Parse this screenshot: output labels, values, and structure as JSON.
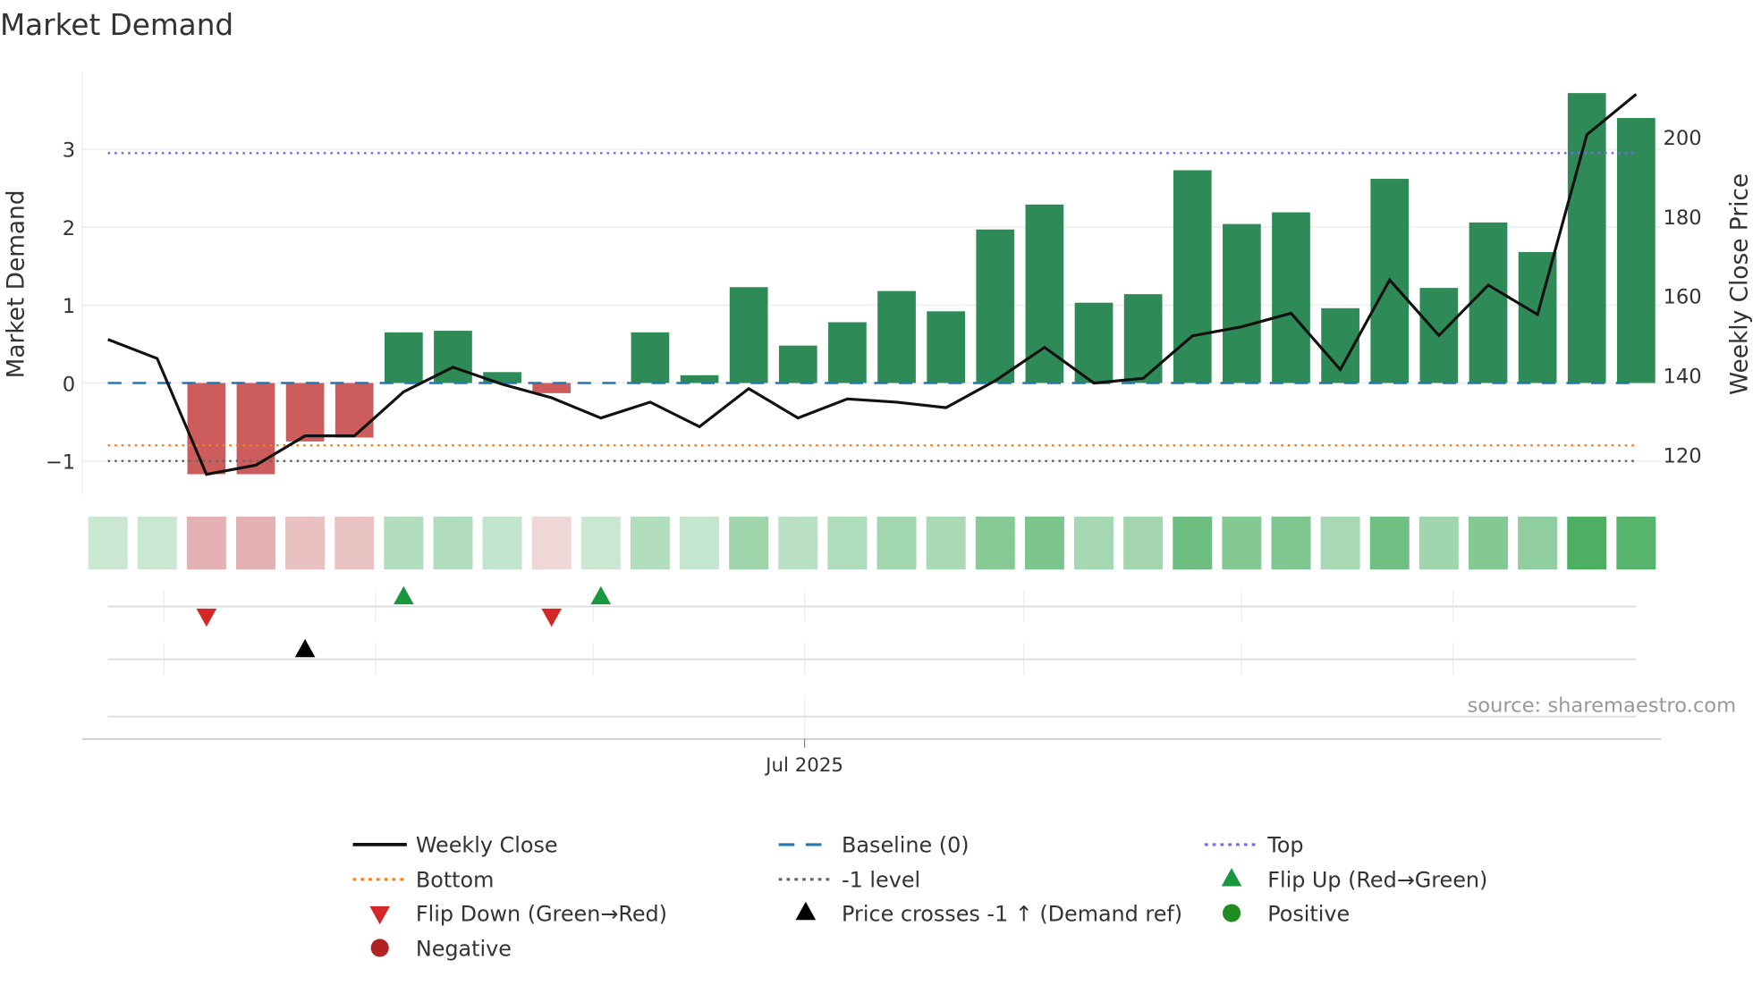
{
  "chart_data": {
    "type": "bar",
    "title": "Market Demand",
    "ylabel": "Market Demand",
    "y2label": "Weekly Close Price",
    "ylim": [
      -1.45,
      3.95
    ],
    "y2lim": [
      111.5,
      212.5
    ],
    "yticks": [
      -1,
      0,
      1,
      2,
      3
    ],
    "ytick_labels": [
      "−1",
      "0",
      "1",
      "2",
      "3"
    ],
    "y2ticks": [
      120,
      140,
      160,
      180,
      200
    ],
    "y2tick_labels": [
      "120",
      "140",
      "160",
      "180",
      "200"
    ],
    "xtick_label": "Jul 2025",
    "source": "source: sharemaestro.com",
    "demand": [
      0.0,
      0.0,
      -1.17,
      -1.17,
      -0.75,
      -0.7,
      0.65,
      0.67,
      0.14,
      -0.13,
      0.0,
      0.65,
      0.1,
      1.23,
      0.48,
      0.78,
      1.18,
      0.92,
      1.97,
      2.29,
      1.03,
      1.14,
      2.73,
      2.04,
      2.19,
      0.96,
      2.62,
      1.22,
      2.06,
      1.68,
      3.72,
      3.4
    ],
    "weekly_close": [
      149.0,
      144.2,
      115.0,
      117.3,
      124.7,
      124.7,
      135.8,
      142.0,
      137.7,
      134.3,
      129.2,
      133.2,
      127.0,
      136.6,
      129.2,
      134.0,
      133.2,
      131.8,
      138.6,
      147.0,
      138.0,
      139.2,
      149.9,
      152.2,
      155.6,
      141.4,
      164.0,
      150.0,
      162.7,
      155.3,
      200.6,
      210.8
    ],
    "levels": {
      "top": 2.95,
      "bottom": -0.8,
      "minus_one": -1,
      "baseline": 0
    },
    "flip_up_weeks": [
      6,
      10
    ],
    "flip_down_weeks": [
      2,
      9
    ],
    "price_cross_weeks": [
      4
    ],
    "colors": {
      "positive": "#2e8b57",
      "negative": "#cd5c5c",
      "line": "#111111",
      "top": "#7b68ee",
      "bottom": "#ff7f0e",
      "minus_one": "#666666",
      "baseline": "#1f77b4",
      "flip_up": "#1a9641",
      "flip_down": "#d62728",
      "cross": "#000000"
    },
    "legend": [
      {
        "label": "Weekly Close",
        "symbol": "line"
      },
      {
        "label": "Baseline (0)",
        "symbol": "dash"
      },
      {
        "label": "Top",
        "symbol": "dot-top"
      },
      {
        "label": "Bottom",
        "symbol": "dot-bottom"
      },
      {
        "label": "-1 level",
        "symbol": "dot-minus"
      },
      {
        "label": "Flip Up (Red→Green)",
        "symbol": "tri-up-green"
      },
      {
        "label": "Flip Down (Green→Red)",
        "symbol": "tri-down-red"
      },
      {
        "label": "Price crosses -1 ↑ (Demand ref)",
        "symbol": "tri-up-black"
      },
      {
        "label": "Positive",
        "symbol": "circle-green"
      },
      {
        "label": "Negative",
        "symbol": "circle-red"
      }
    ],
    "legend_placement": "bottom"
  }
}
